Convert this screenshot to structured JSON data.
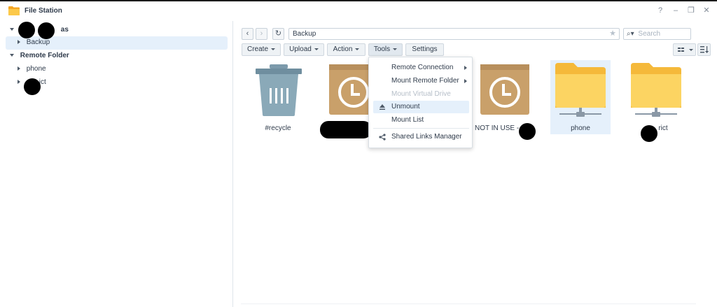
{
  "window": {
    "title": "File Station",
    "help": "?",
    "minimize": "–",
    "restore": "❐",
    "close": "✕"
  },
  "sidebar": {
    "group1_label_tail": "as",
    "items1": [
      "Backup"
    ],
    "group2_label": "Remote Folder",
    "items2": [
      "phone",
      "ict"
    ]
  },
  "toolbar": {
    "back": "‹",
    "forward": "›",
    "refresh": "↻",
    "path": "Backup",
    "search_placeholder": "Search",
    "buttons": [
      "Create",
      "Upload",
      "Action",
      "Tools",
      "Settings"
    ]
  },
  "files": [
    {
      "name": "#recycle",
      "icon": "trash-icon"
    },
    {
      "name": "",
      "icon": "backup-package-icon"
    },
    {
      "name": "NOT IN USE -",
      "icon": "backup-package-icon"
    },
    {
      "name": "phone",
      "icon": "network-folder-icon"
    },
    {
      "name": "rict",
      "icon": "network-folder-icon"
    }
  ],
  "tools_menu": {
    "items": [
      {
        "label": "Remote Connection",
        "submenu": true,
        "disabled": false
      },
      {
        "label": "Mount Remote Folder",
        "submenu": true,
        "disabled": false
      },
      {
        "label": "Mount Virtual Drive",
        "submenu": false,
        "disabled": true
      },
      {
        "label": "Unmount",
        "submenu": false,
        "disabled": false,
        "icon": "eject-icon"
      },
      {
        "label": "Mount List",
        "submenu": false,
        "disabled": false
      },
      {
        "label": "Shared Links Manager",
        "submenu": false,
        "disabled": false,
        "icon": "share-icon"
      }
    ]
  },
  "colors": {
    "folder": "#fcd462",
    "package": "#c9a06a",
    "trash": "#8aa9b8",
    "selection": "#e5f0fb"
  }
}
